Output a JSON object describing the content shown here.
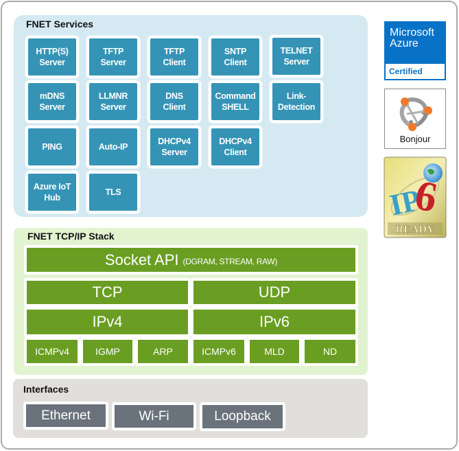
{
  "services": {
    "title": "FNET Services",
    "items": [
      {
        "label": "HTTP(S)\nServer"
      },
      {
        "label": "TFTP\nServer"
      },
      {
        "label": "TFTP\nClient"
      },
      {
        "label": "SNTP\nClient"
      },
      {
        "label": "TELNET\nServer"
      },
      {
        "label": "mDNS\nServer"
      },
      {
        "label": "LLMNR\nServer"
      },
      {
        "label": "DNS\nClient"
      },
      {
        "label": "Command\nSHELL"
      },
      {
        "label": "Link-\nDetection"
      },
      {
        "label": "PING"
      },
      {
        "label": "Auto-IP"
      },
      {
        "label": "DHCPv4\nServer"
      },
      {
        "label": "DHCPv4\nClient"
      },
      {
        "label": "Azure IoT\nHub"
      },
      {
        "label": "TLS"
      }
    ]
  },
  "stack": {
    "title": "FNET TCP/IP Stack",
    "socket_api": "Socket API",
    "socket_api_sub": "(DGRAM, STREAM, RAW)",
    "tcp": "TCP",
    "udp": "UDP",
    "ipv4": "IPv4",
    "ipv6": "IPv6",
    "protocols": [
      "ICMPv4",
      "IGMP",
      "ARP",
      "ICMPv6",
      "MLD",
      "ND"
    ]
  },
  "interfaces": {
    "title": "Interfaces",
    "items": [
      "Ethernet",
      "Wi-Fi",
      "Loopback"
    ]
  },
  "badges": {
    "azure_line1": "Microsoft",
    "azure_line2": "Azure",
    "azure_cert": "Certified",
    "bonjour": "Bonjour",
    "ipv6_ready": "READY",
    "ipv6_logo": "IPv6"
  },
  "colors": {
    "service_tile": "#3594b6",
    "services_bg": "#d4e9f1",
    "stack_block": "#6a9e22",
    "stack_bg": "#e1f3cf",
    "interface_button": "#6a737b",
    "interfaces_bg": "#e1dfdc",
    "azure_blue": "#0872c6"
  }
}
